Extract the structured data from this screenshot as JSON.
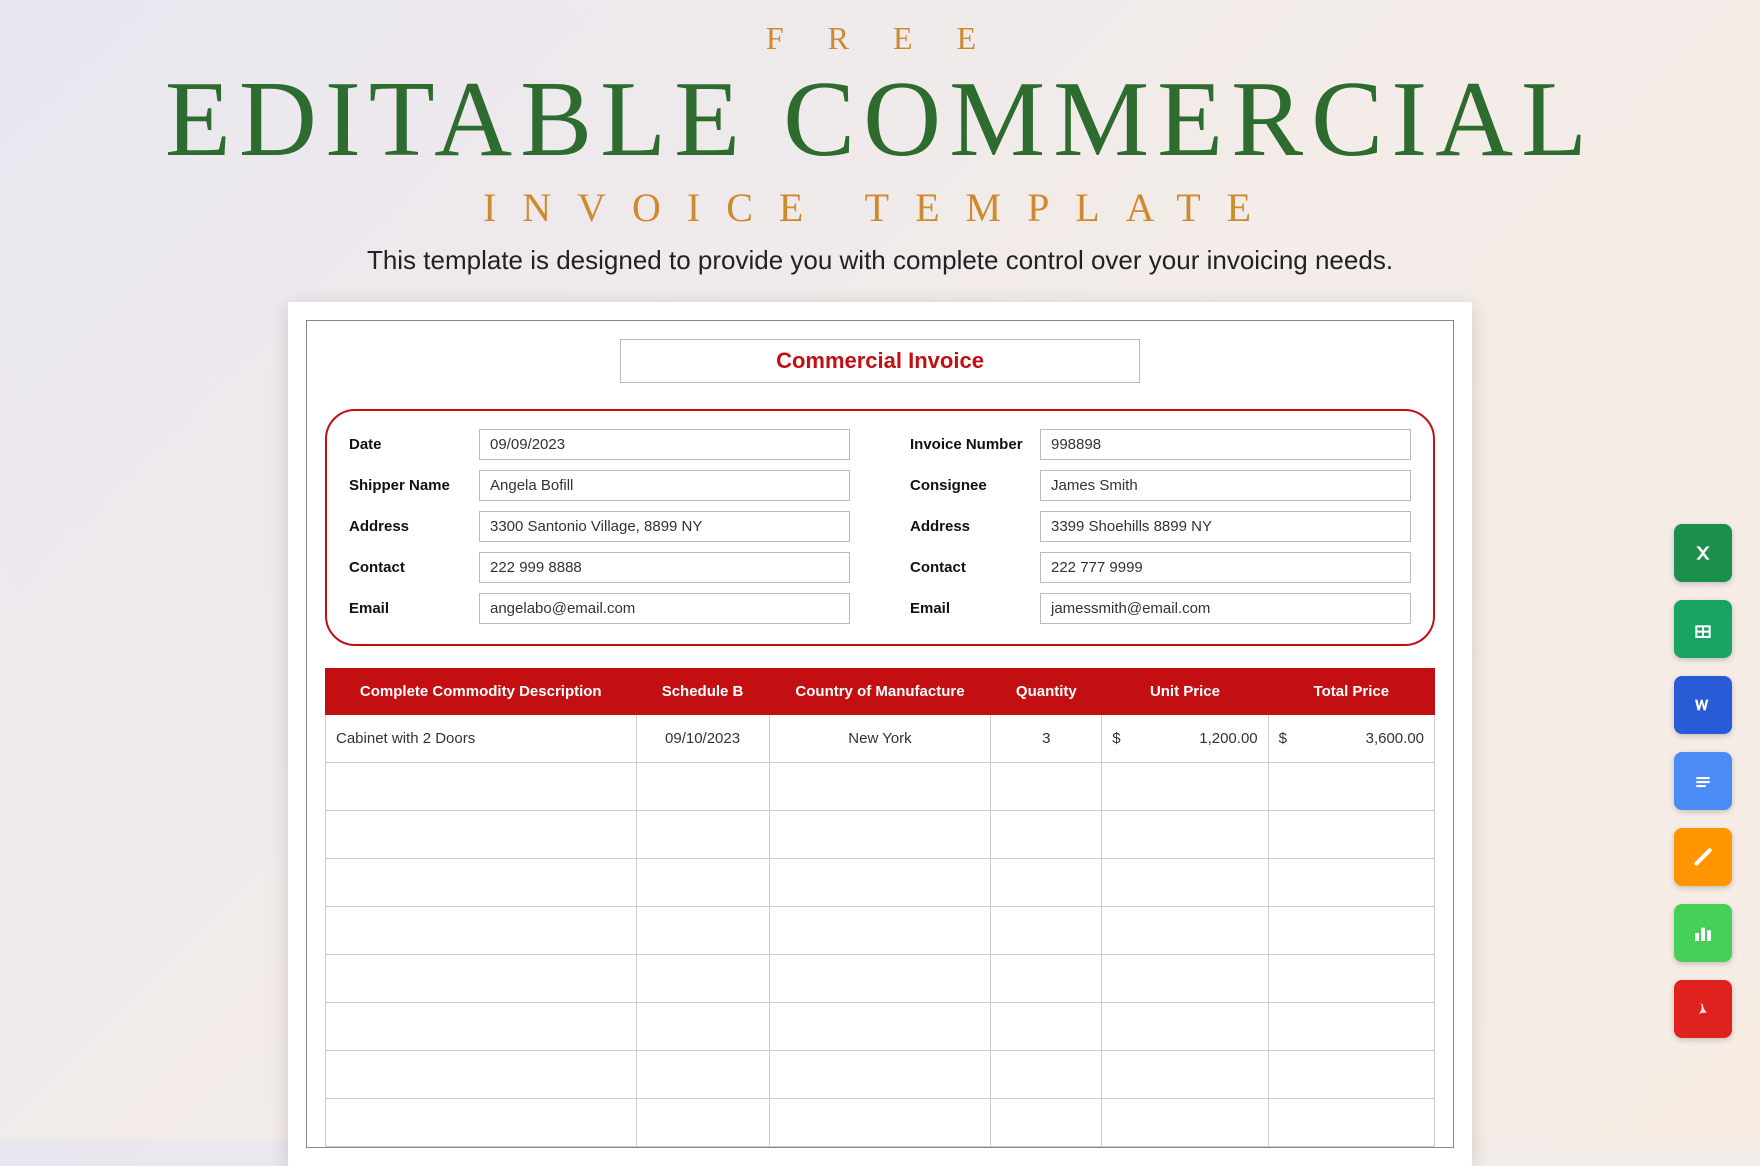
{
  "header": {
    "free": "F R E E",
    "main": "EDITABLE COMMERCIAL",
    "sub": "INVOICE TEMPLATE",
    "tagline": "This template is designed to provide you with complete control over your invoicing needs."
  },
  "invoice": {
    "title": "Commercial Invoice",
    "left": {
      "date_label": "Date",
      "date": "09/09/2023",
      "shipper_label": "Shipper Name",
      "shipper": "Angela Bofill",
      "address_label": "Address",
      "address": "3300 Santonio Village, 8899 NY",
      "contact_label": "Contact",
      "contact": "222 999 8888",
      "email_label": "Email",
      "email": "angelabo@email.com"
    },
    "right": {
      "invno_label": "Invoice Number",
      "invno": "998898",
      "consignee_label": "Consignee",
      "consignee": "James Smith",
      "address_label": "Address",
      "address": "3399 Shoehills 8899 NY",
      "contact_label": "Contact",
      "contact": "222 777 9999",
      "email_label": "Email",
      "email": "jamessmith@email.com"
    },
    "columns": {
      "desc": "Complete Commodity Description",
      "sched": "Schedule B",
      "country": "Country of Manufacture",
      "qty": "Quantity",
      "unit": "Unit Price",
      "total": "Total Price"
    },
    "rows": [
      {
        "desc": "Cabinet with 2 Doors",
        "sched": "09/10/2023",
        "country": "New York",
        "qty": "3",
        "unit_cur": "$",
        "unit": "1,200.00",
        "total_cur": "$",
        "total": "3,600.00"
      }
    ],
    "empty_rows": 8
  },
  "formats": {
    "excel": "excel-icon",
    "gsheets": "google-sheets-icon",
    "word": "word-icon",
    "gdocs": "google-docs-icon",
    "pages": "pages-icon",
    "numbers": "numbers-icon",
    "pdf": "pdf-icon"
  }
}
